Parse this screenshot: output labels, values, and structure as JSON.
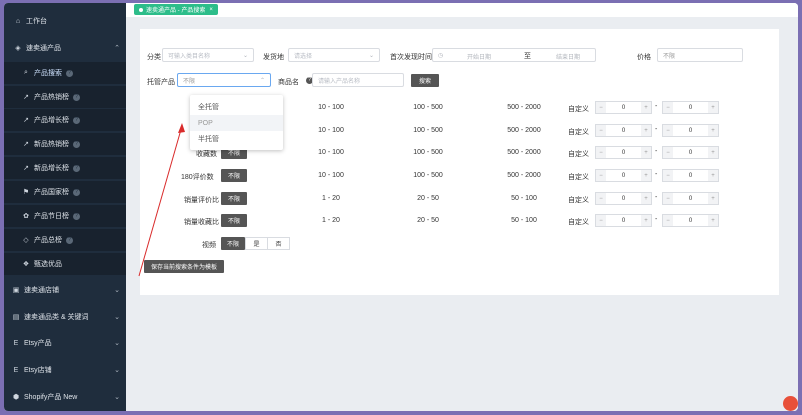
{
  "sidebar": {
    "items": [
      {
        "label": "工作台",
        "icon": "home-icon",
        "level": "top"
      },
      {
        "label": "速卖通产品",
        "icon": "cube-icon",
        "level": "top",
        "expanded": true
      },
      {
        "label": "产品搜索",
        "icon": "search-icon",
        "level": "sub",
        "active": true
      },
      {
        "label": "产品热销榜",
        "icon": "trend-icon",
        "level": "sub"
      },
      {
        "label": "产品增长榜",
        "icon": "growth-icon",
        "level": "sub"
      },
      {
        "label": "新品热销榜",
        "icon": "trend-icon",
        "level": "sub"
      },
      {
        "label": "新品增长榜",
        "icon": "growth-icon",
        "level": "sub"
      },
      {
        "label": "产品国家榜",
        "icon": "flag-icon",
        "level": "sub"
      },
      {
        "label": "产品节日榜",
        "icon": "gift-icon",
        "level": "sub"
      },
      {
        "label": "产品总榜",
        "icon": "shield-icon",
        "level": "sub"
      },
      {
        "label": "甄选优品",
        "icon": "star-icon",
        "level": "sub"
      },
      {
        "label": "速卖通店铺",
        "icon": "store-icon",
        "level": "top"
      },
      {
        "label": "速卖通品类 & 关键词",
        "icon": "tag-icon",
        "level": "top"
      },
      {
        "label": "Etsy产品",
        "icon": "etsy-icon",
        "level": "top"
      },
      {
        "label": "Etsy店铺",
        "icon": "etsy-icon",
        "level": "top"
      },
      {
        "label": "Shopify产品 New",
        "icon": "shopify-icon",
        "level": "top"
      }
    ],
    "arrow": "⌄"
  },
  "tab": {
    "label": "速卖通产品 - 产品搜索",
    "close": "×"
  },
  "filters": {
    "category": {
      "label": "分类",
      "placeholder": "可输入类目名称"
    },
    "ship_from": {
      "label": "发货地",
      "placeholder": "请选择"
    },
    "first_found": {
      "label": "首次发现时间",
      "start": "开始日期",
      "sep": "至",
      "end": "结束日期"
    },
    "price": {
      "label": "价格",
      "value": "不限"
    },
    "hosting": {
      "label": "托管产品",
      "value": "不限"
    },
    "product_name": {
      "label": "商品名",
      "placeholder": "请输入产品名称"
    },
    "search_btn": "搜索"
  },
  "dropdown": {
    "options": [
      "全托管",
      "POP",
      "半托管"
    ]
  },
  "rows": [
    {
      "label": "",
      "btn": "",
      "r1": "10 - 100",
      "r2": "100 - 500",
      "r3": "500 - 2000",
      "custom": "自定义"
    },
    {
      "label": "",
      "btn": "",
      "r1": "10 - 100",
      "r2": "100 - 500",
      "r3": "500 - 2000",
      "custom": "自定义"
    },
    {
      "label": "收藏数",
      "btn": "不限",
      "r1": "10 - 100",
      "r2": "100 - 500",
      "r3": "500 - 2000",
      "custom": "自定义"
    },
    {
      "label": "180评价数",
      "btn": "不限",
      "r1": "10 - 100",
      "r2": "100 - 500",
      "r3": "500 - 2000",
      "custom": "自定义"
    },
    {
      "label": "销量评价比",
      "btn": "不限",
      "r1": "1 - 20",
      "r2": "20 - 50",
      "r3": "50 - 100",
      "custom": "自定义"
    },
    {
      "label": "销量收藏比",
      "btn": "不限",
      "r1": "1 - 20",
      "r2": "20 - 50",
      "r3": "50 - 100",
      "custom": "自定义"
    }
  ],
  "stepper": {
    "minus": "−",
    "plus": "+",
    "value": "0",
    "dash": "-"
  },
  "video": {
    "label": "视频",
    "options": [
      "不限",
      "是",
      "否"
    ]
  },
  "save_template": "保存当前搜索条件为模板"
}
